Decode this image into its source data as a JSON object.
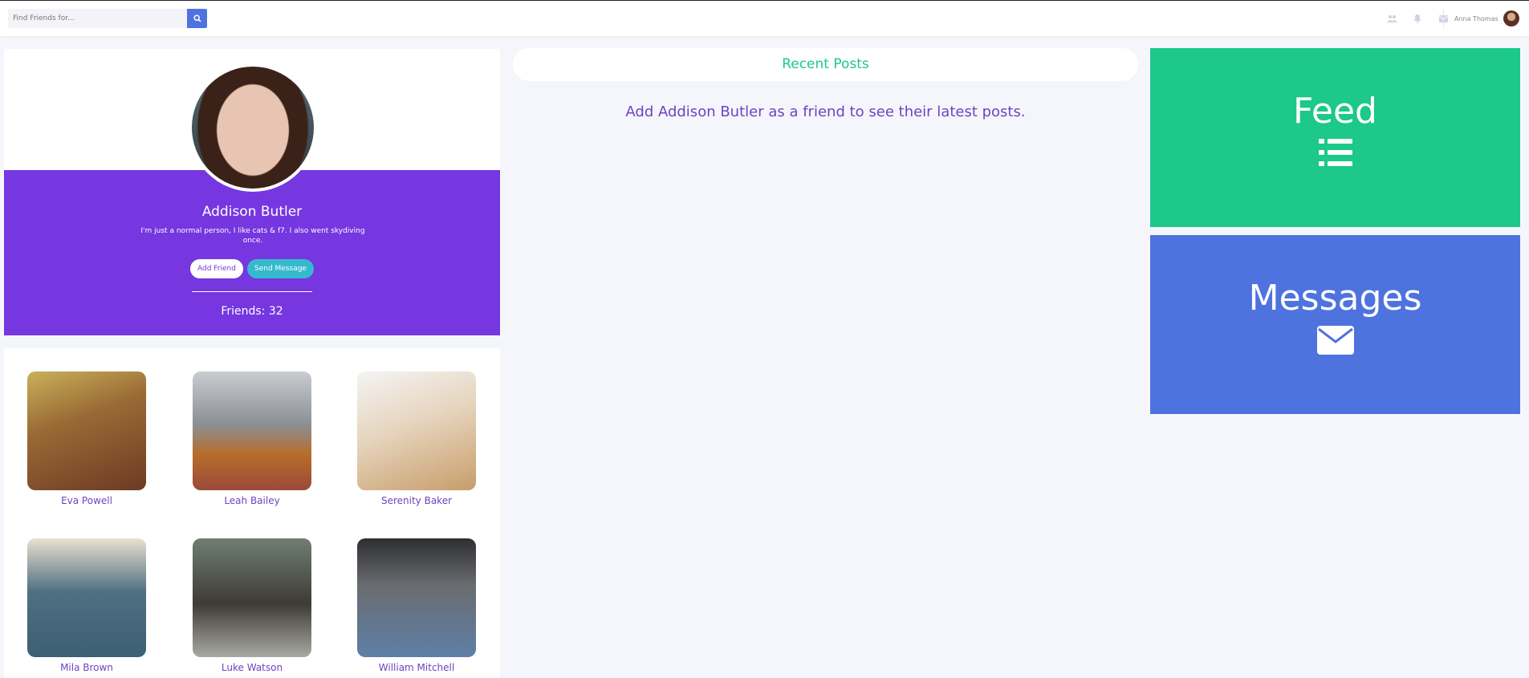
{
  "topbar": {
    "search_placeholder": "Find Friends for...",
    "user_name": "Anna Thomas",
    "icons": [
      "users-icon",
      "bell-icon",
      "envelope-icon"
    ]
  },
  "profile": {
    "name": "Addison Butler",
    "bio": "I'm just a normal person, I like cats & f7. I also went skydiving once.",
    "add_friend_label": "Add Friend",
    "send_message_label": "Send Message",
    "friends_label": "Friends: 32"
  },
  "friends": [
    {
      "name": "Eva Powell"
    },
    {
      "name": "Leah Bailey"
    },
    {
      "name": "Serenity Baker"
    },
    {
      "name": "Mila Brown"
    },
    {
      "name": "Luke Watson"
    },
    {
      "name": "William Mitchell"
    }
  ],
  "posts": {
    "header": "Recent Posts",
    "empty_message": "Add Addison Butler as a friend to see their latest posts."
  },
  "tiles": {
    "feed_label": "Feed",
    "messages_label": "Messages"
  },
  "colors": {
    "purple": "#7636e0",
    "green": "#1cc88a",
    "blue": "#4e73df",
    "cyan": "#36b9cc"
  }
}
